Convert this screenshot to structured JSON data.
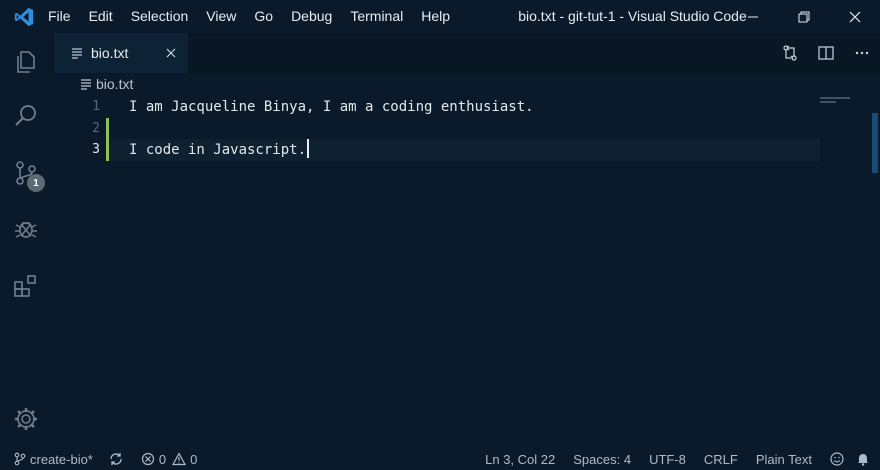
{
  "titlebar": {
    "menu": [
      "File",
      "Edit",
      "Selection",
      "View",
      "Go",
      "Debug",
      "Terminal",
      "Help"
    ],
    "title": "bio.txt - git-tut-1 - Visual Studio Code"
  },
  "activitybar": {
    "icons": [
      "files-icon",
      "search-icon",
      "source-control-icon",
      "debug-icon",
      "extensions-icon"
    ],
    "scm_badge": "1",
    "settings_icon": "gear-icon"
  },
  "tab": {
    "label": "bio.txt"
  },
  "breadcrumb": {
    "file": "bio.txt"
  },
  "editor": {
    "lines": [
      {
        "number": "1",
        "text": "I am Jacqueline Binya, I am a coding enthusiast."
      },
      {
        "number": "2",
        "text": ""
      },
      {
        "number": "3",
        "text": "I code in Javascript."
      }
    ],
    "active_line": 3
  },
  "statusbar": {
    "branch": "create-bio*",
    "errors": "0",
    "warnings": "0",
    "position": "Ln 3, Col 22",
    "spaces": "Spaces: 4",
    "encoding": "UTF-8",
    "eol": "CRLF",
    "language": "Plain Text"
  },
  "colors": {
    "background": "#0b1a2a",
    "gutter_modified": "#8fbf57",
    "text": "#e1e8ee"
  }
}
